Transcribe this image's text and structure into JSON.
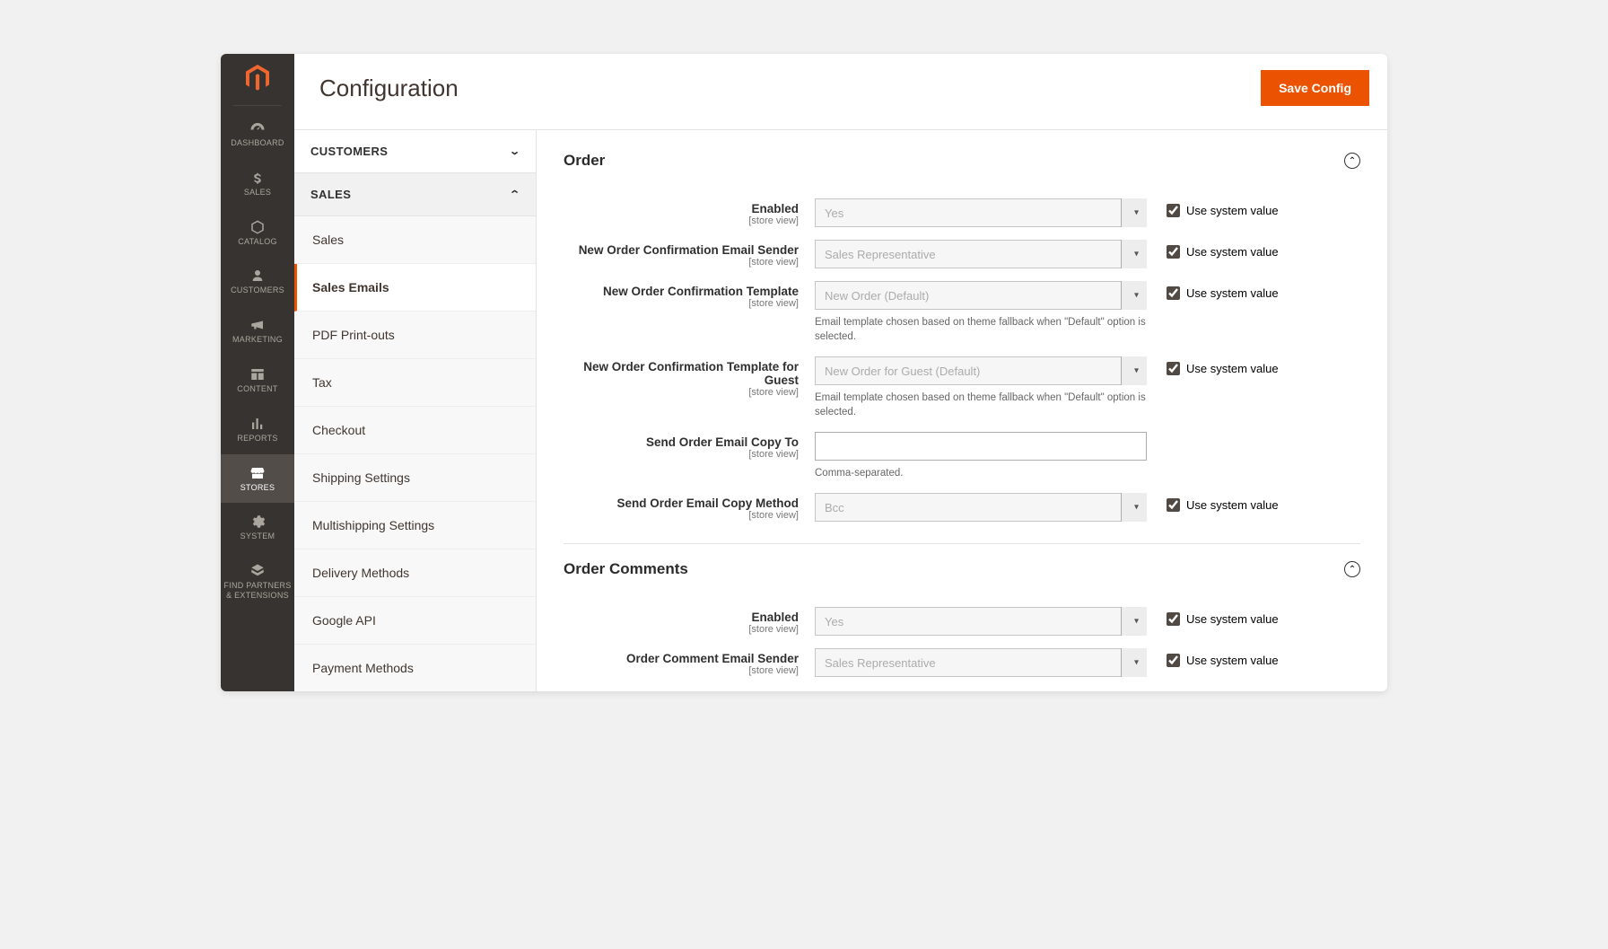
{
  "header": {
    "title": "Configuration",
    "save_label": "Save Config"
  },
  "nav": {
    "items": [
      {
        "label": "DASHBOARD"
      },
      {
        "label": "SALES"
      },
      {
        "label": "CATALOG"
      },
      {
        "label": "CUSTOMERS"
      },
      {
        "label": "MARKETING"
      },
      {
        "label": "CONTENT"
      },
      {
        "label": "REPORTS"
      },
      {
        "label": "STORES"
      },
      {
        "label": "SYSTEM"
      },
      {
        "label": "FIND PARTNERS\n& EXTENSIONS"
      }
    ]
  },
  "sidebar": {
    "groups": [
      {
        "label": "CUSTOMERS",
        "expanded": false
      },
      {
        "label": "SALES",
        "expanded": true,
        "items": [
          {
            "label": "Sales"
          },
          {
            "label": "Sales Emails",
            "active": true
          },
          {
            "label": "PDF Print-outs"
          },
          {
            "label": "Tax"
          },
          {
            "label": "Checkout"
          },
          {
            "label": "Shipping Settings"
          },
          {
            "label": "Multishipping Settings"
          },
          {
            "label": "Delivery Methods"
          },
          {
            "label": "Google API"
          },
          {
            "label": "Payment Methods"
          }
        ]
      }
    ]
  },
  "section_order": {
    "title": "Order",
    "scope": "[store view]",
    "use_system_label": "Use system value",
    "fields": {
      "enabled": {
        "label": "Enabled",
        "value": "Yes"
      },
      "sender": {
        "label": "New Order Confirmation Email Sender",
        "value": "Sales Representative"
      },
      "template": {
        "label": "New Order Confirmation Template",
        "value": "New Order (Default)",
        "helper": "Email template chosen based on theme fallback when \"Default\" option is selected."
      },
      "template_guest": {
        "label": "New Order Confirmation Template for Guest",
        "value": "New Order for Guest (Default)",
        "helper": "Email template chosen based on theme fallback when \"Default\" option is selected."
      },
      "copy_to": {
        "label": "Send Order Email Copy To",
        "value": "",
        "helper": "Comma-separated."
      },
      "copy_method": {
        "label": "Send Order Email Copy Method",
        "value": "Bcc"
      }
    }
  },
  "section_comments": {
    "title": "Order Comments",
    "fields": {
      "enabled": {
        "label": "Enabled",
        "value": "Yes"
      },
      "sender": {
        "label": "Order Comment Email Sender",
        "value": "Sales Representative"
      }
    }
  }
}
